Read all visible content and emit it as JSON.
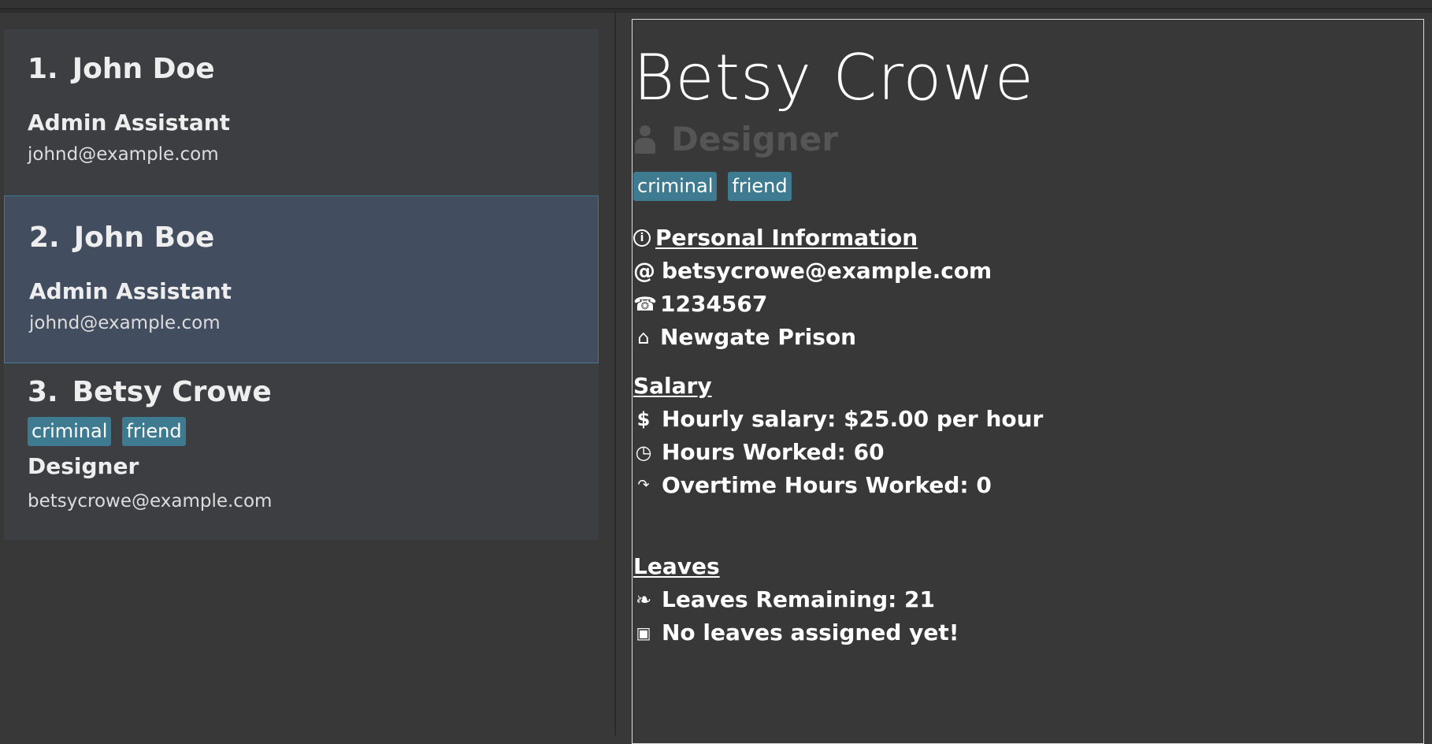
{
  "person_list": [
    {
      "index": "1.",
      "name": "John Doe",
      "role": "Admin Assistant",
      "email": "johnd@example.com",
      "tags": [],
      "selected": false
    },
    {
      "index": "2.",
      "name": "John Boe",
      "role": "Admin Assistant",
      "email": "johnd@example.com",
      "tags": [],
      "selected": true
    },
    {
      "index": "3.",
      "name": "Betsy Crowe",
      "role": "Designer",
      "email": "betsycrowe@example.com",
      "tags": [
        "criminal",
        "friend"
      ],
      "selected": false
    }
  ],
  "detail": {
    "name": "Betsy Crowe",
    "role": "Designer",
    "tags": [
      "criminal",
      "friend"
    ],
    "personal_info": {
      "title": "Personal Information",
      "email": "betsycrowe@example.com",
      "phone": "1234567",
      "address": "Newgate Prison"
    },
    "salary": {
      "title": "Salary",
      "hourly": "Hourly salary: $25.00 per hour",
      "hours_worked": "Hours Worked: 60",
      "overtime": "Overtime Hours Worked: 0"
    },
    "leaves": {
      "title": "Leaves",
      "remaining": "Leaves Remaining: 21",
      "assigned": "No leaves assigned yet!"
    }
  },
  "icons": {
    "info": "info-icon",
    "email": "at-icon",
    "phone": "phone-icon",
    "address": "home-icon",
    "salary": "dollar-icon",
    "hours": "clock-icon",
    "overtime": "overtime-arrow-icon",
    "leaves": "leaf-icon",
    "calendar": "calendar-icon"
  },
  "colors": {
    "background": "#383838",
    "card": "#3c3e42",
    "card_selected": "#424d5f",
    "accent": "#3e7b91",
    "muted_text": "#555555"
  }
}
